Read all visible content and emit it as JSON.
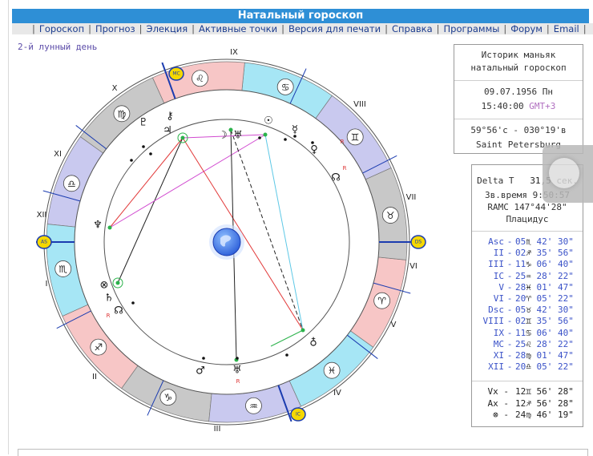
{
  "title": "Натальный гороскоп",
  "nav": [
    "Гороскоп",
    "Прогноз",
    "Элекция",
    "Активные точки",
    "Версия для печати",
    "Справка",
    "Программы",
    "Форум",
    "Email"
  ],
  "lunar_day": "2-й лунный день",
  "info": {
    "name_line1": "Историк маньяк",
    "name_line2": "натальный гороскоп",
    "date": "09.07.1956 Пн",
    "time": "15:40:00",
    "gmt": "GMT+3",
    "coords": "59°56'с - 030°19'в",
    "city": "Saint Petersburg"
  },
  "details": {
    "delta_label": "Delta T",
    "delta_value": "31,5 сек.",
    "sidereal": "Зв.время  9:50:57",
    "ramc": "RAMC 147°44'28\"",
    "system": "Плацидус"
  },
  "houses": [
    {
      "name": "Asc",
      "deg": "05",
      "sign": "♏",
      "min": "42' 30\""
    },
    {
      "name": "II",
      "deg": "02",
      "sign": "♐",
      "min": "35' 56\""
    },
    {
      "name": "III",
      "deg": "11",
      "sign": "♑",
      "min": "06' 40\""
    },
    {
      "name": "IC",
      "deg": "25",
      "sign": "♒",
      "min": "28' 22\""
    },
    {
      "name": "V",
      "deg": "28",
      "sign": "♓",
      "min": "01' 47\""
    },
    {
      "name": "VI",
      "deg": "20",
      "sign": "♈",
      "min": "05' 22\""
    },
    {
      "name": "Dsc",
      "deg": "05",
      "sign": "♉",
      "min": "42' 30\""
    },
    {
      "name": "VIII",
      "deg": "02",
      "sign": "♊",
      "min": "35' 56\""
    },
    {
      "name": "IX",
      "deg": "11",
      "sign": "♋",
      "min": "06' 40\""
    },
    {
      "name": "MC",
      "deg": "25",
      "sign": "♌",
      "min": "28' 22\""
    },
    {
      "name": "XI",
      "deg": "28",
      "sign": "♍",
      "min": "01' 47\""
    },
    {
      "name": "XII",
      "deg": "20",
      "sign": "♎",
      "min": "05' 22\""
    }
  ],
  "angles": [
    {
      "name": "Vx",
      "value": "12♊ 56' 28\""
    },
    {
      "name": "Ax",
      "value": "12♐ 56' 28\""
    },
    {
      "name": "⊗",
      "value": "24♍ 46' 19\""
    }
  ],
  "chart": {
    "house_labels": [
      "I",
      "II",
      "III",
      "IV",
      "V",
      "VI",
      "VII",
      "VIII",
      "IX",
      "X",
      "XI",
      "XII"
    ],
    "angle_badges": [
      "AS",
      "DS",
      "MC",
      "IC"
    ],
    "signs": [
      "♈",
      "♉",
      "♊",
      "♋",
      "♌",
      "♍",
      "♎",
      "♏",
      "♐",
      "♑",
      "♒",
      "♓"
    ],
    "planets": [
      "☽",
      "♅",
      "☉",
      "☿",
      "♀",
      "☊",
      "♆",
      "♇",
      "♃",
      "⚷",
      "♄",
      "♂",
      "♁",
      "♅",
      "⊗",
      "☊"
    ],
    "retro_mark": "R",
    "colors": {
      "fire": "#f7c6c6",
      "earth": "#c8c8c8",
      "air": "#c9c9ef",
      "water": "#a6e6f5",
      "trine": "#e23a3a",
      "square": "#d14ad0",
      "sextile": "#5ec8e6",
      "opposition": "#222222",
      "earth_globe": "#2a5cd8"
    }
  }
}
